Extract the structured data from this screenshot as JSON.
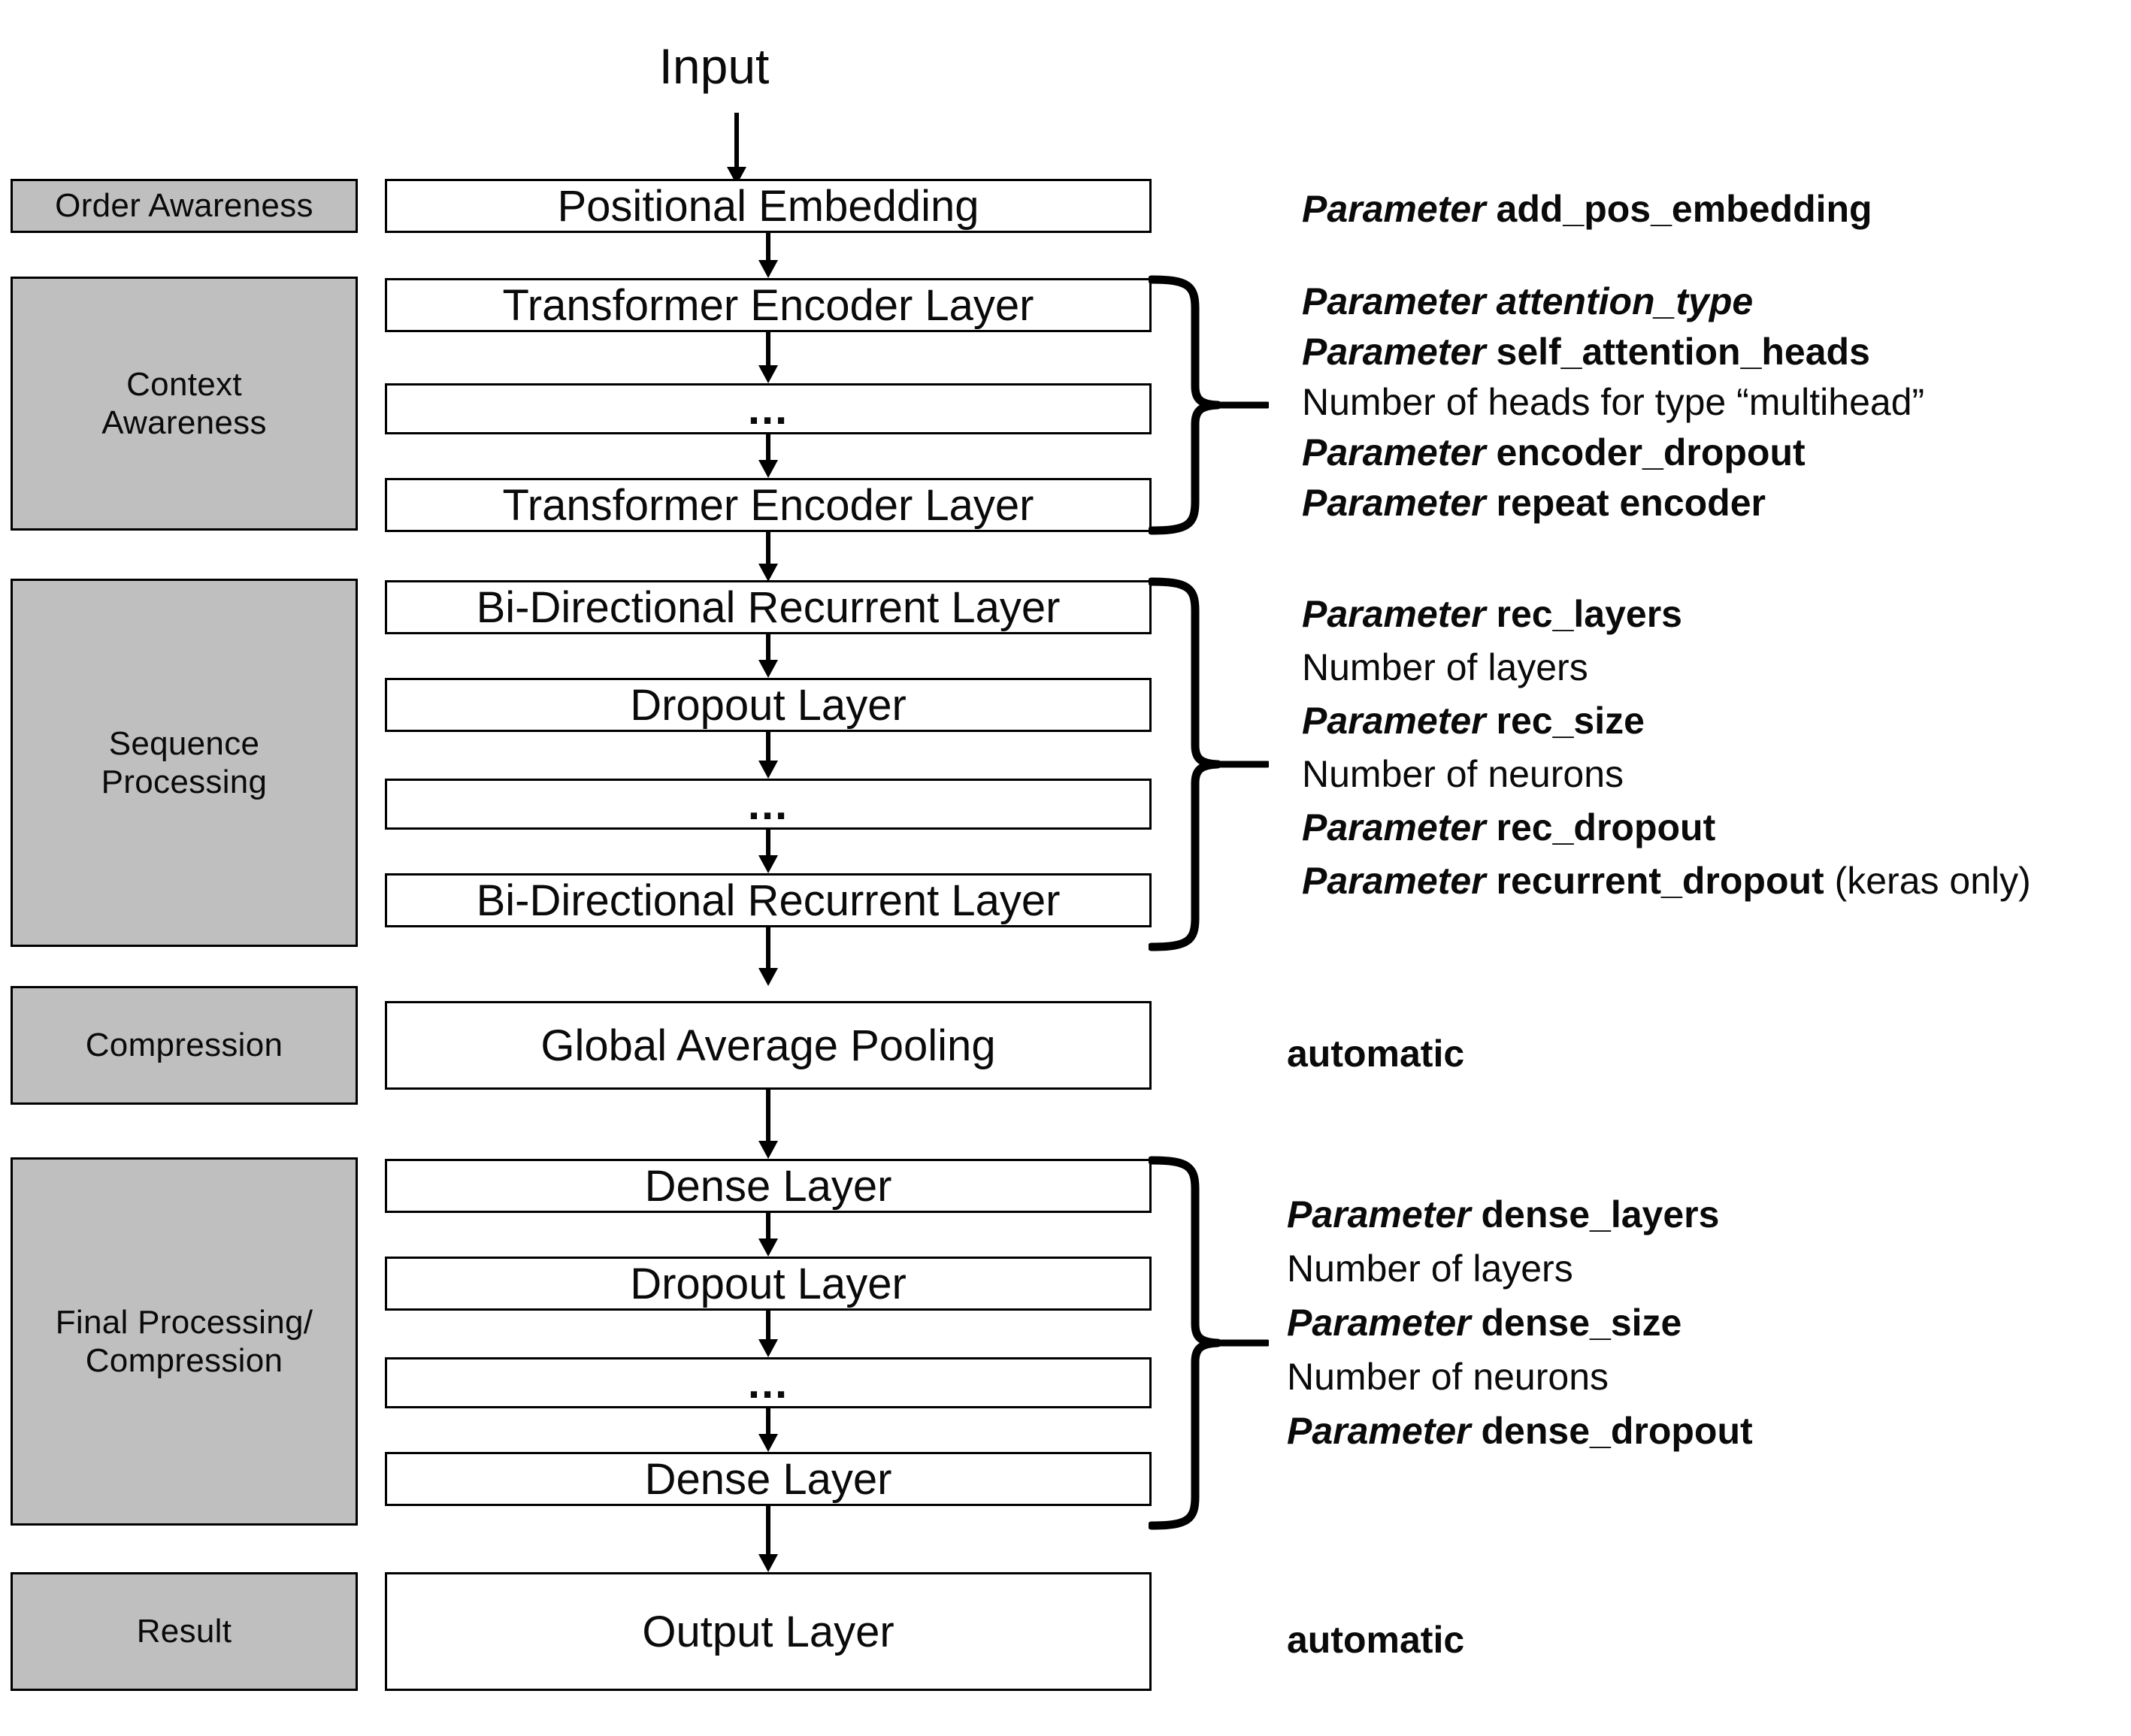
{
  "figure": {
    "input_label": "Input"
  },
  "categories": [
    {
      "label": "Order Awareness"
    },
    {
      "label": "Context\nAwareness"
    },
    {
      "label": "Sequence\nProcessing"
    },
    {
      "label": "Compression"
    },
    {
      "label": "Final Processing/\nCompression"
    },
    {
      "label": "Result"
    }
  ],
  "nodes": {
    "positional_embedding": "Positional Embedding",
    "transformer_encoder_first": "Transformer Encoder Layer",
    "encoder_ellipsis": "...",
    "transformer_encoder_last": "Transformer Encoder Layer",
    "recurrent_first": "Bi-Directional Recurrent Layer",
    "recurrent_dropout_box": "Dropout Layer",
    "recurrent_ellipsis": "...",
    "recurrent_last": "Bi-Directional Recurrent Layer",
    "global_average_pooling": "Global Average Pooling",
    "dense_first": "Dense Layer",
    "dense_dropout_box": "Dropout Layer",
    "dense_ellipsis": "...",
    "dense_last": "Dense Layer",
    "output_layer": "Output Layer"
  },
  "annotations": {
    "order_awareness": [
      {
        "keyword": "Parameter",
        "name": "add_pos_embedding",
        "name_italic": false,
        "suffix": ""
      }
    ],
    "context_awareness": [
      {
        "keyword": "Parameter",
        "name": "attention_type",
        "name_italic": true,
        "suffix": ""
      },
      {
        "keyword": "Parameter",
        "name": "self_attention_heads",
        "name_italic": false,
        "suffix": ""
      },
      {
        "description": "Number of heads for type “multihead”"
      },
      {
        "keyword": "Parameter",
        "name": "encoder_dropout",
        "name_italic": false,
        "suffix": ""
      },
      {
        "keyword": "Parameter",
        "name": "repeat encoder",
        "name_italic": false,
        "suffix": ""
      }
    ],
    "sequence_processing": [
      {
        "keyword": "Parameter",
        "name": "rec_layers",
        "name_italic": false,
        "suffix": ""
      },
      {
        "description": "Number of layers"
      },
      {
        "keyword": "Parameter",
        "name": "rec_size",
        "name_italic": false,
        "suffix": ""
      },
      {
        "description": "Number of neurons"
      },
      {
        "keyword": "Parameter",
        "name": "rec_dropout",
        "name_italic": false,
        "suffix": ""
      },
      {
        "keyword": "Parameter",
        "name": "recurrent_dropout",
        "name_italic": false,
        "suffix": " (keras only)"
      }
    ],
    "compression": [
      {
        "auto": "automatic"
      }
    ],
    "final_processing": [
      {
        "keyword": "Parameter",
        "name": "dense_layers",
        "name_italic": false,
        "suffix": ""
      },
      {
        "description": "Number of layers"
      },
      {
        "keyword": "Parameter",
        "name": "dense_size",
        "name_italic": false,
        "suffix": ""
      },
      {
        "description": "Number of neurons"
      },
      {
        "keyword": "Parameter",
        "name": "dense_dropout",
        "name_italic": false,
        "suffix": ""
      }
    ],
    "result": [
      {
        "auto": "automatic"
      }
    ]
  },
  "colors": {
    "category_fill": "#bfbfbf",
    "node_fill": "#ffffff",
    "stroke": "#000000",
    "text": "#0a0a0a"
  }
}
